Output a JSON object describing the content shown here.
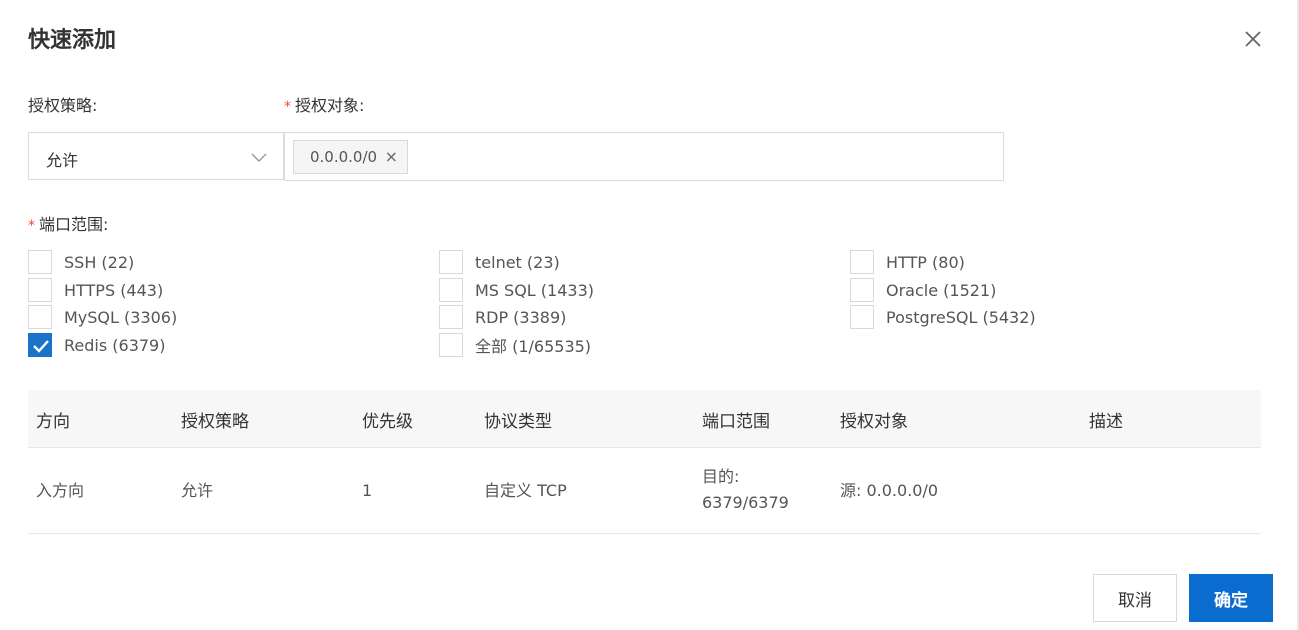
{
  "dialog": {
    "title": "快速添加",
    "close_icon": "close-icon"
  },
  "form": {
    "policy_label": "授权策略:",
    "policy_value": "允许",
    "target_label": "授权对象:",
    "target_tag": "0.0.0.0/0",
    "port_label": "端口范围:"
  },
  "ports": [
    {
      "label": "SSH (22)",
      "checked": false
    },
    {
      "label": "telnet (23)",
      "checked": false
    },
    {
      "label": "HTTP (80)",
      "checked": false
    },
    {
      "label": "HTTPS (443)",
      "checked": false
    },
    {
      "label": "MS SQL (1433)",
      "checked": false
    },
    {
      "label": "Oracle (1521)",
      "checked": false
    },
    {
      "label": "MySQL (3306)",
      "checked": false
    },
    {
      "label": "RDP (3389)",
      "checked": false
    },
    {
      "label": "PostgreSQL (5432)",
      "checked": false
    },
    {
      "label": "Redis (6379)",
      "checked": true
    },
    {
      "label": "全部 (1/65535)",
      "checked": false
    }
  ],
  "table": {
    "headers": [
      "方向",
      "授权策略",
      "优先级",
      "协议类型",
      "端口范围",
      "授权对象",
      "描述"
    ],
    "row": {
      "direction": "入方向",
      "policy": "允许",
      "priority": "1",
      "protocol": "自定义 TCP",
      "port_line1": "目的:",
      "port_line2": "6379/6379",
      "target": "源: 0.0.0.0/0",
      "description": ""
    }
  },
  "buttons": {
    "cancel": "取消",
    "ok": "确定"
  },
  "colors": {
    "primary": "#0a6ccf",
    "required": "#e84c3d",
    "checked": "#1a73c8"
  }
}
